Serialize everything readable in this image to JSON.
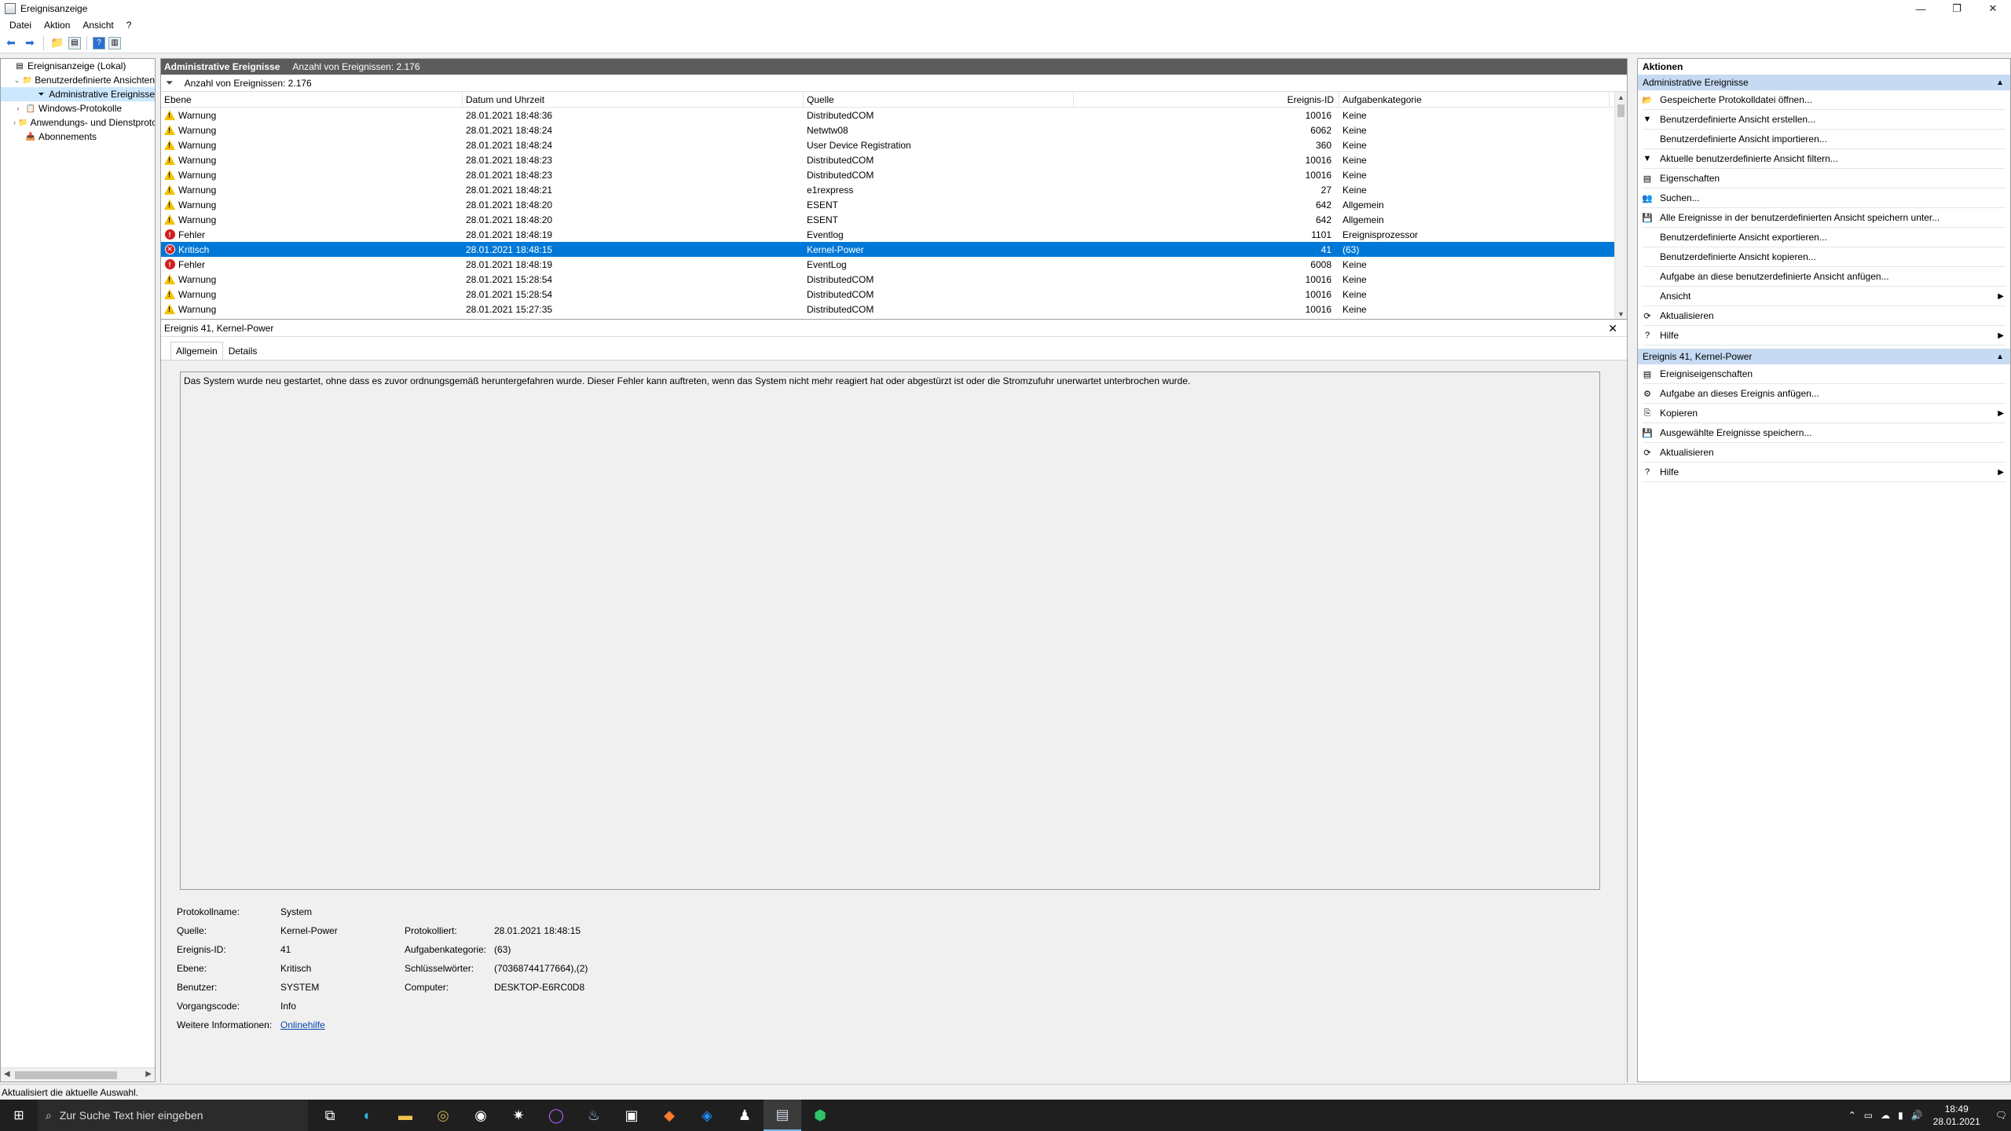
{
  "window": {
    "title": "Ereignisanzeige",
    "min": "—",
    "max": "❐",
    "close": "✕"
  },
  "menu": [
    "Datei",
    "Aktion",
    "Ansicht",
    "?"
  ],
  "tree": [
    {
      "label": "Ereignisanzeige (Lokal)",
      "indent": 0,
      "exp": ""
    },
    {
      "label": "Benutzerdefinierte Ansichten",
      "indent": 1,
      "exp": "⌄"
    },
    {
      "label": "Administrative Ereignisse",
      "indent": 2,
      "exp": ""
    },
    {
      "label": "Windows-Protokolle",
      "indent": 1,
      "exp": "›"
    },
    {
      "label": "Anwendungs- und Dienstprotokolle",
      "indent": 1,
      "exp": "›"
    },
    {
      "label": "Abonnements",
      "indent": 1,
      "exp": ""
    }
  ],
  "center": {
    "header_title": "Administrative Ereignisse",
    "header_count": "Anzahl von Ereignissen: 2.176",
    "filter_text": "Anzahl von Ereignissen: 2.176",
    "columns": [
      "Ebene",
      "Datum und Uhrzeit",
      "Quelle",
      "Ereignis-ID",
      "Aufgabenkategorie"
    ],
    "rows": [
      {
        "level": "Warnung",
        "type": "warn",
        "date": "28.01.2021 18:48:36",
        "source": "DistributedCOM",
        "id": "10016",
        "category": "Keine"
      },
      {
        "level": "Warnung",
        "type": "warn",
        "date": "28.01.2021 18:48:24",
        "source": "Netwtw08",
        "id": "6062",
        "category": "Keine"
      },
      {
        "level": "Warnung",
        "type": "warn",
        "date": "28.01.2021 18:48:24",
        "source": "User Device Registration",
        "id": "360",
        "category": "Keine"
      },
      {
        "level": "Warnung",
        "type": "warn",
        "date": "28.01.2021 18:48:23",
        "source": "DistributedCOM",
        "id": "10016",
        "category": "Keine"
      },
      {
        "level": "Warnung",
        "type": "warn",
        "date": "28.01.2021 18:48:23",
        "source": "DistributedCOM",
        "id": "10016",
        "category": "Keine"
      },
      {
        "level": "Warnung",
        "type": "warn",
        "date": "28.01.2021 18:48:21",
        "source": "e1rexpress",
        "id": "27",
        "category": "Keine"
      },
      {
        "level": "Warnung",
        "type": "warn",
        "date": "28.01.2021 18:48:20",
        "source": "ESENT",
        "id": "642",
        "category": "Allgemein"
      },
      {
        "level": "Warnung",
        "type": "warn",
        "date": "28.01.2021 18:48:20",
        "source": "ESENT",
        "id": "642",
        "category": "Allgemein"
      },
      {
        "level": "Fehler",
        "type": "err",
        "date": "28.01.2021 18:48:19",
        "source": "Eventlog",
        "id": "1101",
        "category": "Ereignisprozessor"
      },
      {
        "level": "Kritisch",
        "type": "crit",
        "date": "28.01.2021 18:48:15",
        "source": "Kernel-Power",
        "id": "41",
        "category": "(63)",
        "selected": true
      },
      {
        "level": "Fehler",
        "type": "err",
        "date": "28.01.2021 18:48:19",
        "source": "EventLog",
        "id": "6008",
        "category": "Keine"
      },
      {
        "level": "Warnung",
        "type": "warn",
        "date": "28.01.2021 15:28:54",
        "source": "DistributedCOM",
        "id": "10016",
        "category": "Keine"
      },
      {
        "level": "Warnung",
        "type": "warn",
        "date": "28.01.2021 15:28:54",
        "source": "DistributedCOM",
        "id": "10016",
        "category": "Keine"
      },
      {
        "level": "Warnung",
        "type": "warn",
        "date": "28.01.2021 15:27:35",
        "source": "DistributedCOM",
        "id": "10016",
        "category": "Keine"
      }
    ]
  },
  "detail": {
    "title": "Ereignis 41, Kernel-Power",
    "tabs": [
      "Allgemein",
      "Details"
    ],
    "message": "Das System wurde neu gestartet, ohne dass es zuvor ordnungsgemäß heruntergefahren wurde. Dieser Fehler kann auftreten, wenn das System nicht mehr reagiert hat oder abgestürzt ist oder die Stromzufuhr unerwartet unterbrochen wurde.",
    "props": {
      "protokollname_label": "Protokollname:",
      "protokollname": "System",
      "quelle_label": "Quelle:",
      "quelle": "Kernel-Power",
      "protokolliert_label": "Protokolliert:",
      "protokolliert": "28.01.2021 18:48:15",
      "id_label": "Ereignis-ID:",
      "id": "41",
      "kategorie_label": "Aufgabenkategorie:",
      "kategorie": "(63)",
      "ebene_label": "Ebene:",
      "ebene": "Kritisch",
      "keywords_label": "Schlüsselwörter:",
      "keywords": "(70368744177664),(2)",
      "benutzer_label": "Benutzer:",
      "benutzer": "SYSTEM",
      "computer_label": "Computer:",
      "computer": "DESKTOP-E6RC0D8",
      "vorgang_label": "Vorgangscode:",
      "vorgang": "Info",
      "weitere_label": "Weitere Informationen:",
      "weitere_link": "Onlinehilfe"
    }
  },
  "actions": {
    "title": "Aktionen",
    "section1": "Administrative Ereignisse",
    "items1": [
      {
        "label": "Gespeicherte Protokolldatei öffnen...",
        "icon": "📂"
      },
      {
        "label": "Benutzerdefinierte Ansicht erstellen...",
        "icon": "▼"
      },
      {
        "label": "Benutzerdefinierte Ansicht importieren...",
        "icon": ""
      },
      {
        "label": "Aktuelle benutzerdefinierte Ansicht filtern...",
        "icon": "▼"
      },
      {
        "label": "Eigenschaften",
        "icon": "▤"
      },
      {
        "label": "Suchen...",
        "icon": "👥"
      },
      {
        "label": "Alle Ereignisse in der benutzerdefinierten Ansicht speichern unter...",
        "icon": "💾"
      },
      {
        "label": "Benutzerdefinierte Ansicht exportieren...",
        "icon": ""
      },
      {
        "label": "Benutzerdefinierte Ansicht kopieren...",
        "icon": ""
      },
      {
        "label": "Aufgabe an diese benutzerdefinierte Ansicht anfügen...",
        "icon": ""
      },
      {
        "label": "Ansicht",
        "icon": "",
        "sub": "▶"
      },
      {
        "label": "Aktualisieren",
        "icon": "⟳"
      },
      {
        "label": "Hilfe",
        "icon": "?",
        "sub": "▶"
      }
    ],
    "section2": "Ereignis 41, Kernel-Power",
    "items2": [
      {
        "label": "Ereigniseigenschaften",
        "icon": "▤"
      },
      {
        "label": "Aufgabe an dieses Ereignis anfügen...",
        "icon": "⚙"
      },
      {
        "label": "Kopieren",
        "icon": "⎘",
        "sub": "▶"
      },
      {
        "label": "Ausgewählte Ereignisse speichern...",
        "icon": "💾"
      },
      {
        "label": "Aktualisieren",
        "icon": "⟳"
      },
      {
        "label": "Hilfe",
        "icon": "?",
        "sub": "▶"
      }
    ]
  },
  "status": "Aktualisiert die aktuelle Auswahl.",
  "taskbar": {
    "search_placeholder": "Zur Suche Text hier eingeben",
    "time": "18:49",
    "date": "28.01.2021"
  }
}
